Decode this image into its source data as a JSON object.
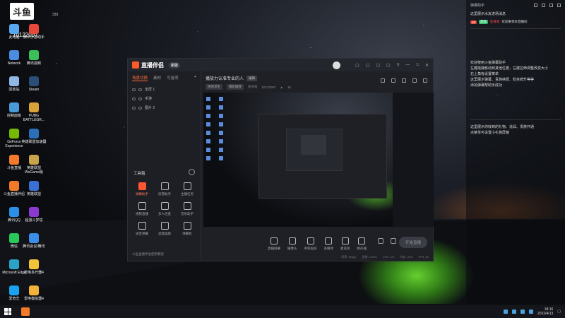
{
  "overlay": {
    "logo_text": "斗鱼",
    "room_id": "10122097",
    "count": "333"
  },
  "desktop": {
    "icons": [
      {
        "label": "此电脑",
        "color": "#5aa9f0"
      },
      {
        "label": "腾讯手游助手",
        "color": "#e8483b"
      },
      {
        "label": "Network",
        "color": "#4a8de0"
      },
      {
        "label": "腾讯视频",
        "color": "#3cbe5a"
      },
      {
        "label": "回收站",
        "color": "#8fb8e6"
      },
      {
        "label": "Steam",
        "color": "#2a4e77"
      },
      {
        "label": "控制面板",
        "color": "#4b9ad8"
      },
      {
        "label": "PUBG BATTLEGR...",
        "color": "#d8a23a"
      },
      {
        "label": "GeForce Experience",
        "color": "#76b900"
      },
      {
        "label": "英雄联盟加速器",
        "color": "#2a6fb8"
      },
      {
        "label": "斗鱼直播",
        "color": "#f27a2a"
      },
      {
        "label": "英雄联盟 WeGame版",
        "color": "#c9a34a"
      },
      {
        "label": "斗鱼直播伴侣",
        "color": "#f27a2a"
      },
      {
        "label": "英雄联盟",
        "color": "#3b6fd1"
      },
      {
        "label": "腾讯QQ",
        "color": "#2b90e8"
      },
      {
        "label": "超激斗梦境",
        "color": "#8b3ad1"
      },
      {
        "label": "微信",
        "color": "#2ac75b"
      },
      {
        "label": "腾讯会议/腾讯",
        "color": "#3b8ee8"
      },
      {
        "label": "Microsoft Edge",
        "color": "#2aa3c7"
      },
      {
        "label": "雷电多开器4",
        "color": "#f2c43a"
      },
      {
        "label": "爱奇艺",
        "color": "#18a2ef"
      },
      {
        "label": "雷电模拟器4",
        "color": "#f2b23a"
      }
    ]
  },
  "app": {
    "name": "直播伴侣",
    "version": "新版",
    "tabs": [
      "场景切换",
      "素材",
      "可选项"
    ],
    "scenes": [
      "全屏 1",
      "手游",
      "图片 2"
    ],
    "tools_title": "工具箱",
    "tools": [
      "弹幕助手",
      "房管助手",
      "主播任务",
      "视频直播",
      "多人连麦",
      "音乐助手",
      "语音弹幕",
      "滤镜美颜",
      "弹幕机"
    ],
    "left_footer": "斗鱼直播伴侣使用教程",
    "room_title": "播放力认准专业的人",
    "room_edit": "编辑",
    "room_meta": [
      "绝地求生",
      "精彩推荐",
      "房间号",
      "10122097"
    ],
    "room_hot": "16",
    "bottom_buttons": [
      "直播屏幕",
      "摄像头",
      "手机投屏",
      "多媒体",
      "麦克风",
      "扬声器"
    ],
    "start_live": "开始直播",
    "status": [
      "码率: 0kbps",
      "丢帧: 0.00%",
      "CPU: 4%",
      "内存: 39%",
      "FPS: 60"
    ]
  },
  "chat": {
    "header": "弹幕助手",
    "lines1": [
      "这里展示水友进场消息"
    ],
    "user_badge": "10",
    "user_level": "超级",
    "user_name": "匹骨家",
    "user_msg": "欢迎来到本直播间",
    "lines2": [
      "欢迎使用斗鱼弹幕助手",
      "左键拖拽移动到其他位置，左键拉伸调整改变大小",
      "右上角有设置菜单",
      "这里展示弹幕、贵族续费、粉丝牌升等等",
      "添加弹幕帮助手成功"
    ],
    "lines3": [
      "这里展示你收到的礼物、道具、贵族开通",
      "点菜单可设置小礼物屏蔽"
    ]
  },
  "taskbar": {
    "time": "18:16",
    "date": "2022/4/13"
  }
}
